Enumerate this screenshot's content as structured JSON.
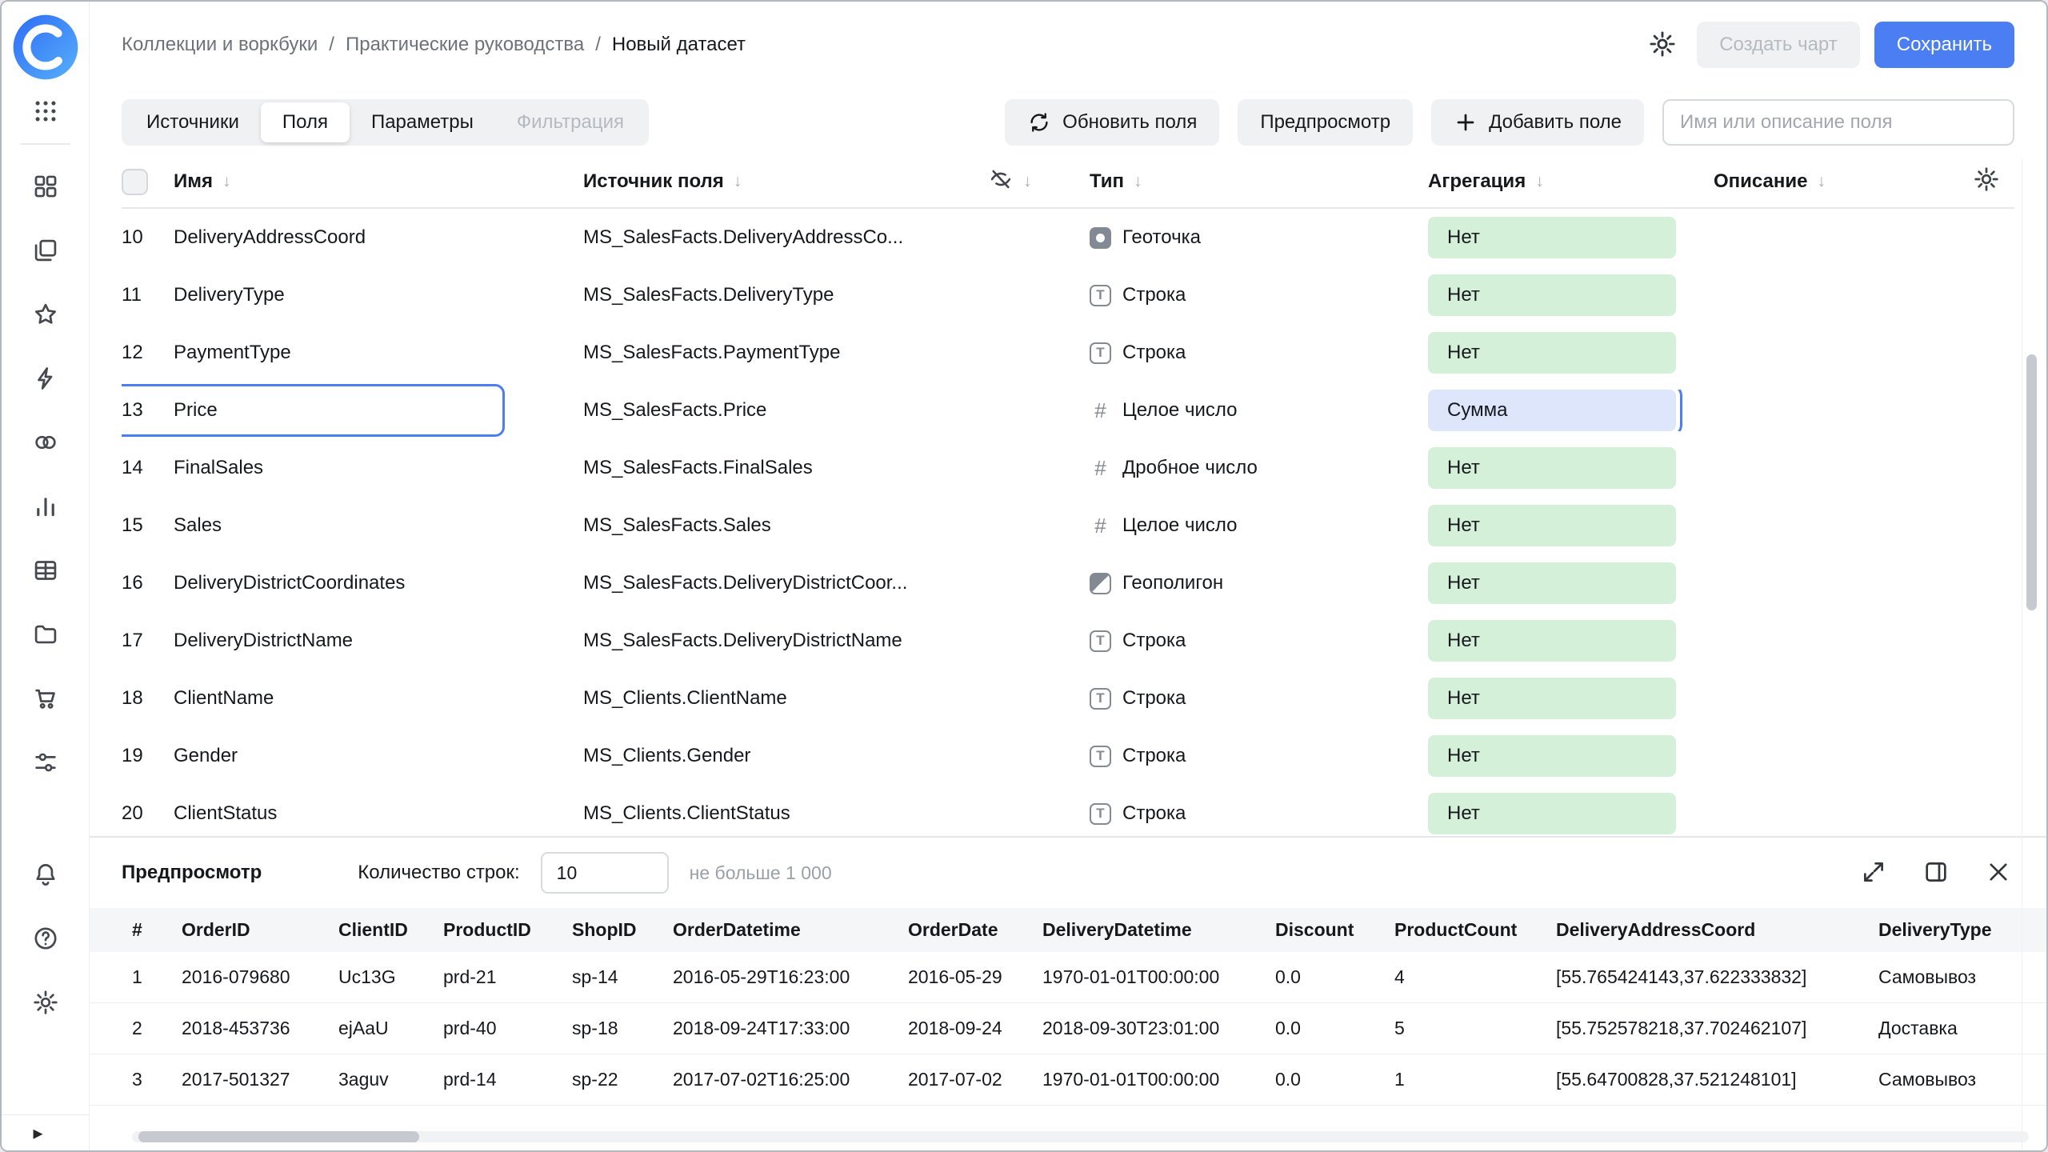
{
  "header": {
    "breadcrumbs": [
      "Коллекции и воркбуки",
      "Практические руководства",
      "Новый датасет"
    ],
    "create_chart": "Создать чарт",
    "save": "Сохранить"
  },
  "tabs": {
    "sources": "Источники",
    "fields": "Поля",
    "parameters": "Параметры",
    "filtration": "Фильтрация"
  },
  "actions": {
    "refresh_fields": "Обновить поля",
    "preview": "Предпросмотр",
    "add_field": "Добавить поле",
    "search_placeholder": "Имя или описание поля"
  },
  "icons": {
    "sort_arrow": "↓",
    "collapse_arrow": "▸",
    "separator": "/",
    "type_string_glyph": "T",
    "type_number_glyph": "#"
  },
  "fields_table": {
    "col_name": "Имя",
    "col_source": "Источник поля",
    "col_type": "Тип",
    "col_aggregation": "Агрегация",
    "col_description": "Описание",
    "rows": [
      {
        "num": "10",
        "name": "DeliveryAddressCoord",
        "source": "MS_SalesFacts.DeliveryAddressCo...",
        "type": "Геоточка",
        "type_icon": "geopoint",
        "aggregation": "Нет",
        "agg_style": "green",
        "selected": false
      },
      {
        "num": "11",
        "name": "DeliveryType",
        "source": "MS_SalesFacts.DeliveryType",
        "type": "Строка",
        "type_icon": "string",
        "aggregation": "Нет",
        "agg_style": "green",
        "selected": false
      },
      {
        "num": "12",
        "name": "PaymentType",
        "source": "MS_SalesFacts.PaymentType",
        "type": "Строка",
        "type_icon": "string",
        "aggregation": "Нет",
        "agg_style": "green",
        "selected": false
      },
      {
        "num": "13",
        "name": "Price",
        "source": "MS_SalesFacts.Price",
        "type": "Целое число",
        "type_icon": "integer",
        "aggregation": "Сумма",
        "agg_style": "blue",
        "selected": true
      },
      {
        "num": "14",
        "name": "FinalSales",
        "source": "MS_SalesFacts.FinalSales",
        "type": "Дробное число",
        "type_icon": "float",
        "aggregation": "Нет",
        "agg_style": "green",
        "selected": false
      },
      {
        "num": "15",
        "name": "Sales",
        "source": "MS_SalesFacts.Sales",
        "type": "Целое число",
        "type_icon": "integer",
        "aggregation": "Нет",
        "agg_style": "green",
        "selected": false
      },
      {
        "num": "16",
        "name": "DeliveryDistrictCoordinates",
        "source": "MS_SalesFacts.DeliveryDistrictCoor...",
        "type": "Геополигон",
        "type_icon": "geopolygon",
        "aggregation": "Нет",
        "agg_style": "green",
        "selected": false
      },
      {
        "num": "17",
        "name": "DeliveryDistrictName",
        "source": "MS_SalesFacts.DeliveryDistrictName",
        "type": "Строка",
        "type_icon": "string",
        "aggregation": "Нет",
        "agg_style": "green",
        "selected": false
      },
      {
        "num": "18",
        "name": "ClientName",
        "source": "MS_Clients.ClientName",
        "type": "Строка",
        "type_icon": "string",
        "aggregation": "Нет",
        "agg_style": "green",
        "selected": false
      },
      {
        "num": "19",
        "name": "Gender",
        "source": "MS_Clients.Gender",
        "type": "Строка",
        "type_icon": "string",
        "aggregation": "Нет",
        "agg_style": "green",
        "selected": false
      },
      {
        "num": "20",
        "name": "ClientStatus",
        "source": "MS_Clients.ClientStatus",
        "type": "Строка",
        "type_icon": "string",
        "aggregation": "Нет",
        "agg_style": "green",
        "selected": false
      }
    ]
  },
  "preview": {
    "title": "Предпросмотр",
    "row_count_label": "Количество строк:",
    "row_count_value": "10",
    "row_count_hint": "не больше 1 000",
    "columns": [
      "#",
      "OrderID",
      "ClientID",
      "ProductID",
      "ShopID",
      "OrderDatetime",
      "OrderDate",
      "DeliveryDatetime",
      "Discount",
      "ProductCount",
      "DeliveryAddressCoord",
      "DeliveryType"
    ],
    "rows": [
      [
        "1",
        "2016-079680",
        "Uc13G",
        "prd-21",
        "sp-14",
        "2016-05-29T16:23:00",
        "2016-05-29",
        "1970-01-01T00:00:00",
        "0.0",
        "4",
        "[55.765424143,37.622333832]",
        "Самовывоз"
      ],
      [
        "2",
        "2018-453736",
        "ejAaU",
        "prd-40",
        "sp-18",
        "2018-09-24T17:33:00",
        "2018-09-24",
        "2018-09-30T23:01:00",
        "0.0",
        "5",
        "[55.752578218,37.702462107]",
        "Доставка"
      ],
      [
        "3",
        "2017-501327",
        "3aguv",
        "prd-14",
        "sp-22",
        "2017-07-02T16:25:00",
        "2017-07-02",
        "1970-01-01T00:00:00",
        "0.0",
        "1",
        "[55.64700828,37.521248101]",
        "Самовывоз"
      ]
    ]
  }
}
